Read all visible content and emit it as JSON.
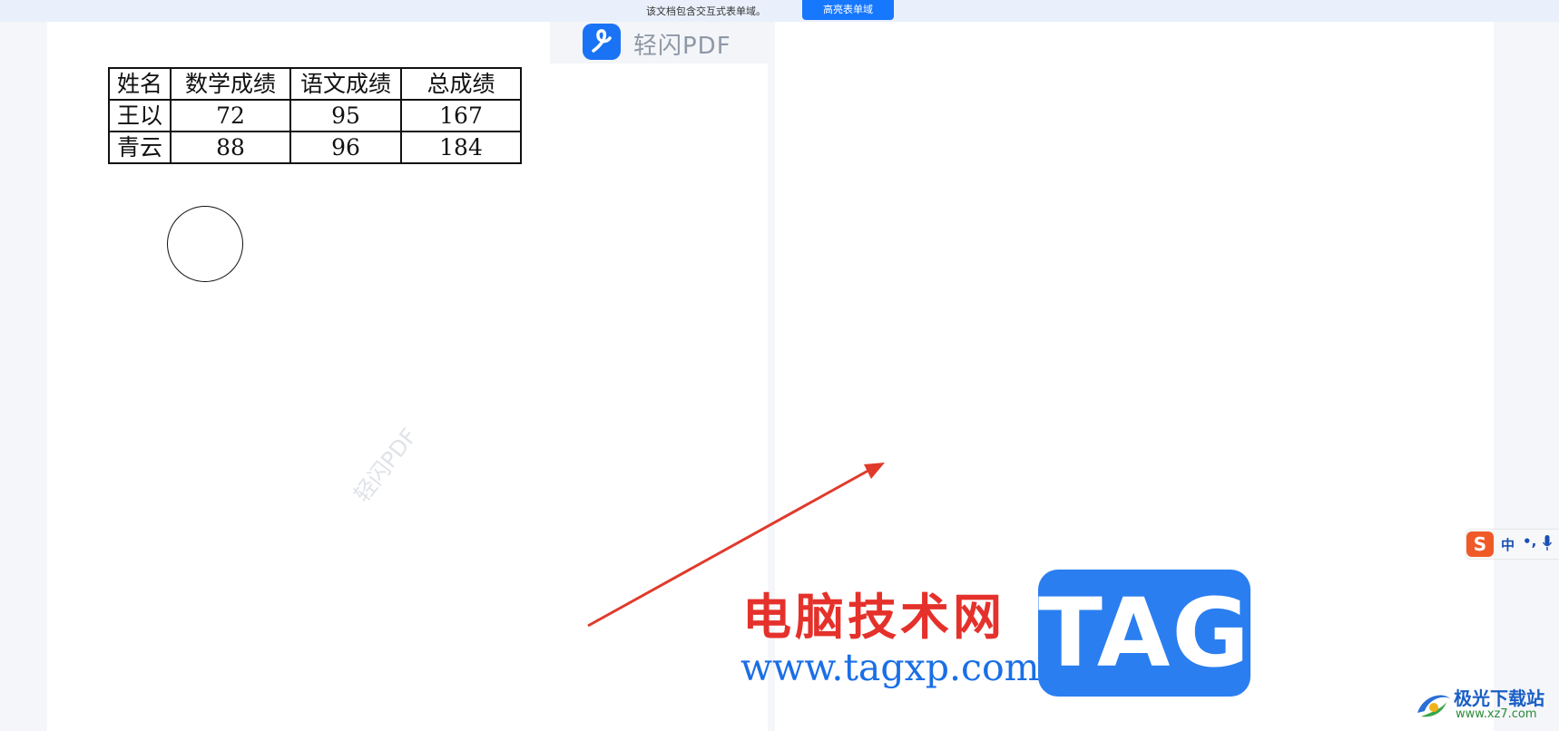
{
  "notice": {
    "text": "该文档包含交互式表单域。",
    "button_label": "高亮表单域"
  },
  "brand": {
    "name": "轻闪PDF",
    "watermark": "轻闪PDF"
  },
  "table": {
    "headers": [
      "姓名",
      "数学成绩",
      "语文成绩",
      "总成绩"
    ],
    "rows": [
      [
        "王以",
        "72",
        "95",
        "167"
      ],
      [
        "青云",
        "88",
        "96",
        "184"
      ]
    ]
  },
  "overlay": {
    "site_title": "电脑技术网",
    "site_url": "www.tagxp.com",
    "tag_label": "TAG",
    "arrow_color": "#e03a2c"
  },
  "ime": {
    "logo": "S",
    "mode": "中",
    "punct": "•,"
  },
  "corner": {
    "name": "极光下载站",
    "url": "www.xz7.com"
  },
  "colors": {
    "accent": "#1677ff",
    "brand_logo": "#1a73f5",
    "tag_bg": "#2a7ef0",
    "title_red": "#e5312b"
  }
}
